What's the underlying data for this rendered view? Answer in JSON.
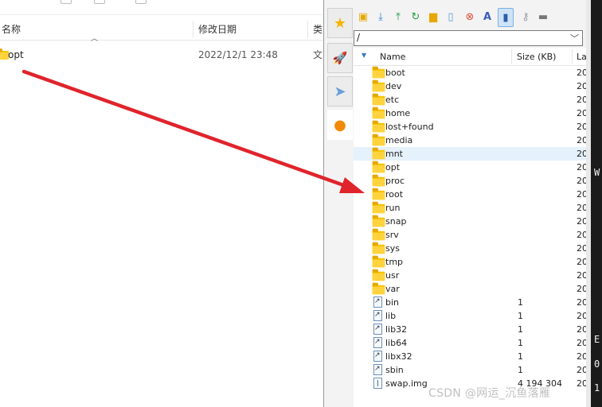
{
  "explorer": {
    "columns": {
      "name": "名称",
      "modified": "修改日期",
      "type": "类"
    },
    "rows": [
      {
        "name": "opt",
        "modified": "2022/12/1 23:48",
        "type": "文"
      }
    ]
  },
  "sftp": {
    "path": "/",
    "columns": {
      "name": "Name",
      "size": "Size (KB)",
      "last": "La"
    },
    "files": [
      {
        "name": "boot",
        "kind": "folder",
        "size": "",
        "last": "20"
      },
      {
        "name": "dev",
        "kind": "folder",
        "size": "",
        "last": "20"
      },
      {
        "name": "etc",
        "kind": "folder",
        "size": "",
        "last": "20"
      },
      {
        "name": "home",
        "kind": "folder",
        "size": "",
        "last": "20"
      },
      {
        "name": "lost+found",
        "kind": "folder",
        "size": "",
        "last": "20"
      },
      {
        "name": "media",
        "kind": "folder",
        "size": "",
        "last": "20"
      },
      {
        "name": "mnt",
        "kind": "folder",
        "size": "",
        "last": "20",
        "selected": true
      },
      {
        "name": "opt",
        "kind": "folder",
        "size": "",
        "last": "20"
      },
      {
        "name": "proc",
        "kind": "folder",
        "size": "",
        "last": "20"
      },
      {
        "name": "root",
        "kind": "folder",
        "size": "",
        "last": "20"
      },
      {
        "name": "run",
        "kind": "folder",
        "size": "",
        "last": "20"
      },
      {
        "name": "snap",
        "kind": "folder",
        "size": "",
        "last": "20"
      },
      {
        "name": "srv",
        "kind": "folder",
        "size": "",
        "last": "20"
      },
      {
        "name": "sys",
        "kind": "folder",
        "size": "",
        "last": "20"
      },
      {
        "name": "tmp",
        "kind": "folder",
        "size": "",
        "last": "20"
      },
      {
        "name": "usr",
        "kind": "folder",
        "size": "",
        "last": "20"
      },
      {
        "name": "var",
        "kind": "folder",
        "size": "",
        "last": "20"
      },
      {
        "name": "bin",
        "kind": "link",
        "size": "1",
        "last": "20"
      },
      {
        "name": "lib",
        "kind": "link",
        "size": "1",
        "last": "20"
      },
      {
        "name": "lib32",
        "kind": "link",
        "size": "1",
        "last": "20"
      },
      {
        "name": "lib64",
        "kind": "link",
        "size": "1",
        "last": "20"
      },
      {
        "name": "libx32",
        "kind": "link",
        "size": "1",
        "last": "20"
      },
      {
        "name": "sbin",
        "kind": "link",
        "size": "1",
        "last": "20"
      },
      {
        "name": "swap.img",
        "kind": "file",
        "size": "4 194 304",
        "last": "20"
      }
    ],
    "toolbar_icons": [
      "upload-folder-icon",
      "download-icon",
      "upload-icon",
      "refresh-icon",
      "new-folder-icon",
      "new-file-icon",
      "delete-icon",
      "rename-icon",
      "sync-browse-icon",
      "key-icon",
      "terminal-icon"
    ],
    "sidebar_icons": [
      "favorites-star-icon",
      "rocket-icon",
      "send-icon",
      "globe-icon"
    ]
  },
  "terminal": {
    "chars": [
      "W",
      "E",
      "0",
      "1"
    ]
  },
  "watermark": "CSDN @网运_沉鱼落雁",
  "colors": {
    "arrow": "#e0242c",
    "selection": "#e5f1fb",
    "folder": "#f7c300"
  }
}
